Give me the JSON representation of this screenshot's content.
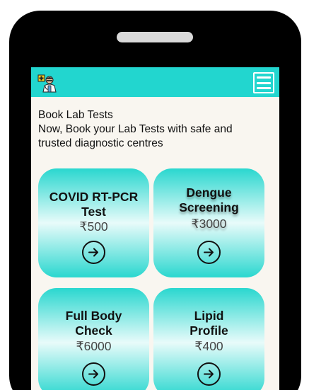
{
  "screen": {
    "title": "Book Lab Tests",
    "subtitle_line1": "Now, Book your Lab Tests with safe and",
    "subtitle_line2": "trusted diagnostic centres"
  },
  "colors": {
    "accent": "#22d6cf",
    "background": "#f9f6f0",
    "phone_frame": "#000000"
  },
  "icons": {
    "logo": "doctor-logo-icon",
    "menu": "hamburger-menu-icon",
    "arrow": "arrow-right-circle-icon"
  },
  "cards": [
    {
      "title_line1": "COVID RT-PCR",
      "title_line2": "Test",
      "price": "₹500"
    },
    {
      "title_line1": "Dengue",
      "title_line2": "Screening",
      "price": "₹3000"
    },
    {
      "title_line1": "Full Body",
      "title_line2": "Check",
      "price": "₹6000"
    },
    {
      "title_line1": "Lipid",
      "title_line2": "Profile",
      "price": "₹400"
    }
  ]
}
